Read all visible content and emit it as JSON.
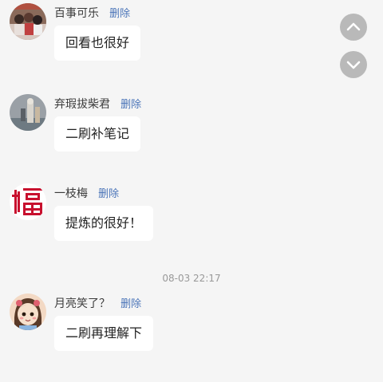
{
  "messages": [
    {
      "sender": "百事可乐",
      "delete_label": "删除",
      "text": "回看也很好",
      "avatar": "group-photo-avatar"
    },
    {
      "sender": "弃瑕拔柴君",
      "delete_label": "删除",
      "text": "二刷补笔记",
      "avatar": "gray-photo-avatar"
    },
    {
      "sender": "一枝梅",
      "delete_label": "删除",
      "text": "提炼的很好！",
      "avatar": "fu-character-avatar"
    },
    {
      "sender": "月亮笑了？",
      "delete_label": "删除",
      "text": "二刷再理解下",
      "avatar": "cartoon-girl-avatar"
    }
  ],
  "timestamp": "08-03 22:17",
  "scroll_controls": {
    "up_icon": "chevron-up-icon",
    "down_icon": "chevron-down-icon"
  },
  "colors": {
    "background": "#f5f5f5",
    "bubble": "#ffffff",
    "delete_link": "#4a74b8",
    "scroll_button": "#b9b9b9",
    "fu_red": "#c8102e"
  }
}
